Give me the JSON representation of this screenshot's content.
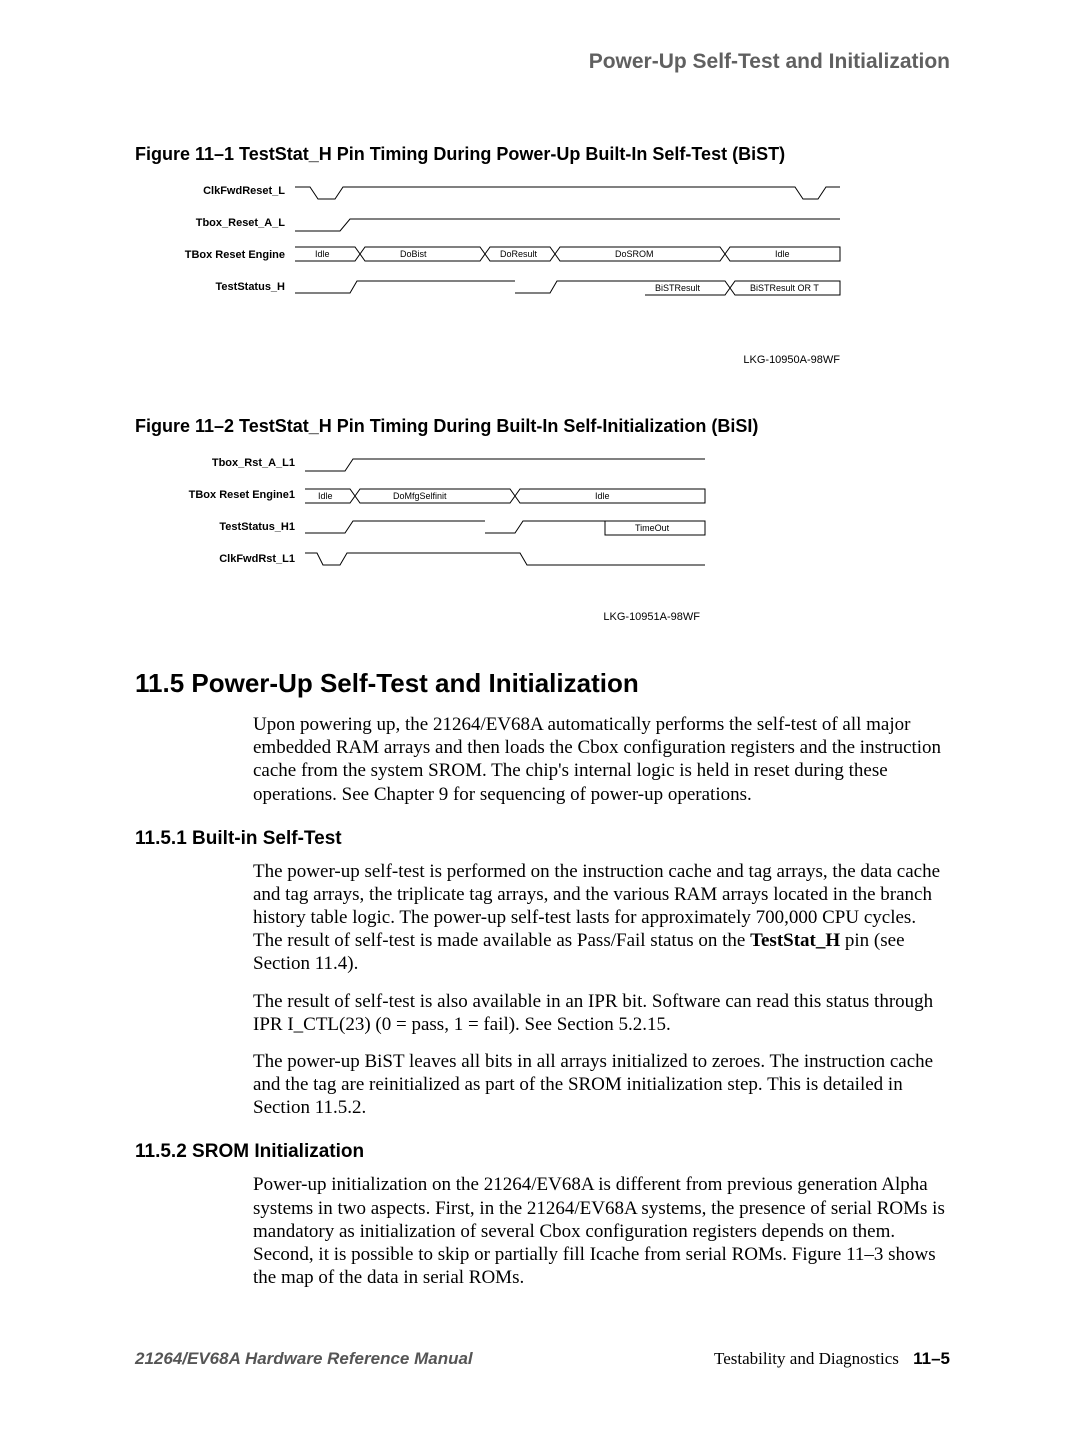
{
  "running_head": "Power-Up Self-Test and Initialization",
  "figure1": {
    "caption": "Figure 11–1  TestStat_H Pin Timing During Power-Up Built-In Self-Test (BiST)",
    "labels": {
      "row1": "ClkFwdReset_L",
      "row2": "Tbox_Reset_A_L",
      "row3": "TBox Reset Engine",
      "row4": "TestStatus_H"
    },
    "states": {
      "idle": "Idle",
      "dobist": "DoBist",
      "doresult": "DoResult",
      "dosrom": "DoSROM",
      "idle2": "Idle",
      "bistresult": "BiSTResult",
      "bistresult_or_t": "BiSTResult OR T"
    },
    "code": "LKG-10950A-98WF"
  },
  "figure2": {
    "caption": "Figure 11–2  TestStat_H Pin Timing During Built-In Self-Initialization (BiSI)",
    "labels": {
      "row1": "Tbox_Rst_A_L1",
      "row2": "TBox Reset Engine1",
      "row3": "TestStatus_H1",
      "row4": "ClkFwdRst_L1"
    },
    "states": {
      "idle": "Idle",
      "domfg": "DoMfgSelfinit",
      "idle2": "Idle",
      "timeout": "TimeOut"
    },
    "code": "LKG-10951A-98WF"
  },
  "section": {
    "num_title": "11.5  Power-Up Self-Test and Initialization",
    "intro": "Upon powering up, the 21264/EV68A automatically performs the self-test of all major embedded RAM arrays and then loads the Cbox configuration registers and the instruction cache from the system SROM. The chip's internal logic is held in reset during these operations. See Chapter 9 for sequencing of power-up operations."
  },
  "sub1": {
    "title": "11.5.1  Built-in Self-Test",
    "p1_a": "The power-up self-test is performed on the instruction cache and tag arrays, the data cache and tag arrays, the triplicate tag arrays, and the various RAM arrays located in the branch history table logic. The power-up self-test lasts for approximately 700,000 CPU cycles. The result of self-test is made available as Pass/Fail status on the ",
    "p1_bold": "TestStat_H",
    "p1_b": " pin (see Section 11.4).",
    "p2": "The result of self-test is also available in an IPR bit. Software can read this status through IPR I_CTL(23) (0 = pass, 1 = fail).  See Section 5.2.15.",
    "p3": "The power-up BiST leaves all bits in all arrays initialized to zeroes. The instruction cache and the tag are reinitialized as part of the SROM initialization step. This is detailed in Section 11.5.2."
  },
  "sub2": {
    "title": "11.5.2  SROM Initialization",
    "p1": "Power-up initialization on the 21264/EV68A is different from previous generation Alpha systems in two aspects. First,  in the 21264/EV68A  systems, the presence of serial ROMs is mandatory as initialization of several Cbox configuration registers depends on them. Second, it is possible to skip or partially fill Icache from serial ROMs. Figure 11–3 shows the map of the data in serial ROMs."
  },
  "footer": {
    "left": "21264/EV68A Hardware Reference Manual",
    "right_text": "Testability and Diagnostics",
    "right_page": "11–5"
  }
}
